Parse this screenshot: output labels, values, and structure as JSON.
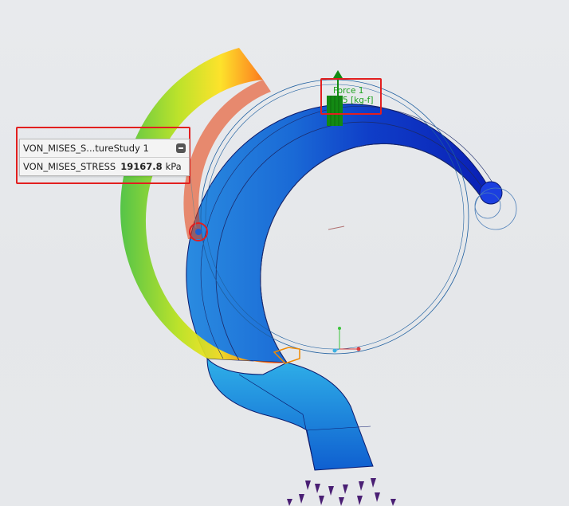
{
  "probe": {
    "title": "VON_MISES_S...tureStudy 1",
    "quantity": "VON_MISES_STRESS",
    "value": "19167.8",
    "unit": "kPa"
  },
  "force": {
    "name": "Force 1",
    "value_text": "5 [kg-f]"
  },
  "colors": {
    "annotation": "#e21f1f",
    "force": "#1ea21e",
    "stress_high": "#e02a00",
    "stress_low": "#0a1fb5"
  }
}
